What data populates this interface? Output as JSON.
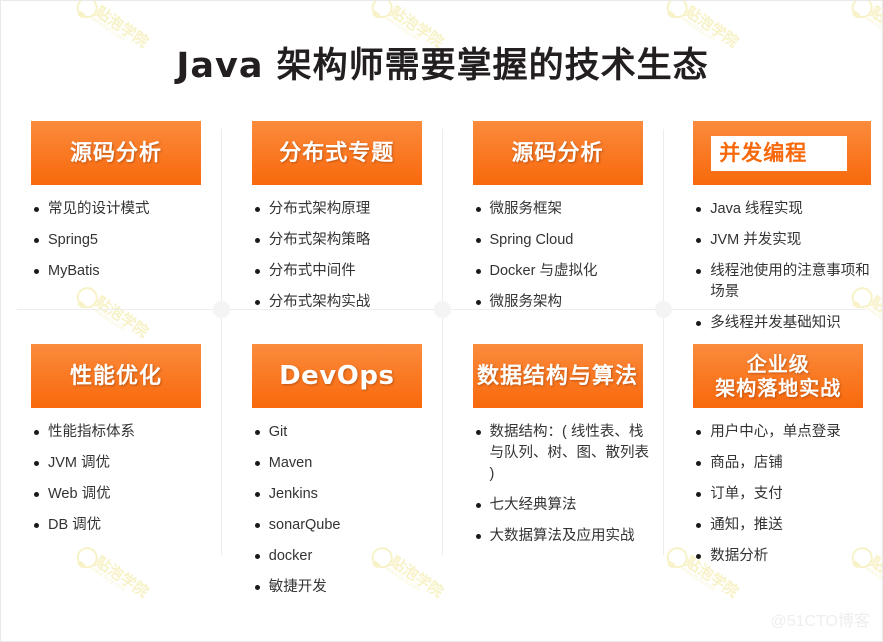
{
  "title": "Java 架构师需要掌握的技术生态",
  "footer_credit": "@51CTO博客",
  "watermark": {
    "line1": "贴泡学院",
    "line2": "www.bzxy.com",
    "icon": "lightbulb-icon",
    "color": "#f7f2c8"
  },
  "theme": {
    "accent_top": "#fb8c3e",
    "accent_bottom": "#f8690c",
    "title_color": "#231f20",
    "body_text": "#333333",
    "separator": "#ededed"
  },
  "rows": [
    {
      "cards": [
        {
          "title": "源码分析",
          "style": "normal",
          "items": [
            "常见的设计模式",
            "Spring5",
            "MyBatis"
          ]
        },
        {
          "title": "分布式专题",
          "style": "normal",
          "items": [
            "分布式架构原理",
            "分布式架构策略",
            "分布式中间件",
            "分布式架构实战"
          ]
        },
        {
          "title": "源码分析",
          "style": "normal",
          "items": [
            "微服务框架",
            "Spring Cloud",
            "Docker 与虚拟化",
            "微服务架构"
          ]
        },
        {
          "title": "并发编程",
          "style": "highlight",
          "items": [
            "Java 线程实现",
            "JVM 并发实现",
            "线程池使用的注意事项和场景",
            "多线程并发基础知识"
          ]
        }
      ]
    },
    {
      "cards": [
        {
          "title": "性能优化",
          "style": "normal",
          "items": [
            "性能指标体系",
            "JVM 调优",
            "Web 调优",
            "DB 调优"
          ]
        },
        {
          "title": "DevOps",
          "style": "latin",
          "items": [
            "Git",
            "Maven",
            "Jenkins",
            "sonarQube",
            "docker",
            "敏捷开发"
          ]
        },
        {
          "title": "数据结构与算法",
          "style": "normal",
          "items": [
            "数据结构：( 线性表、栈与队列、树、图、散列表 )",
            "七大经典算法",
            "大数据算法及应用实战"
          ]
        },
        {
          "title": "企业级\n架构落地实战",
          "style": "two-line",
          "items": [
            "用户中心，单点登录",
            "商品，店铺",
            "订单，支付",
            "通知，推送",
            "数据分析"
          ]
        }
      ]
    }
  ]
}
